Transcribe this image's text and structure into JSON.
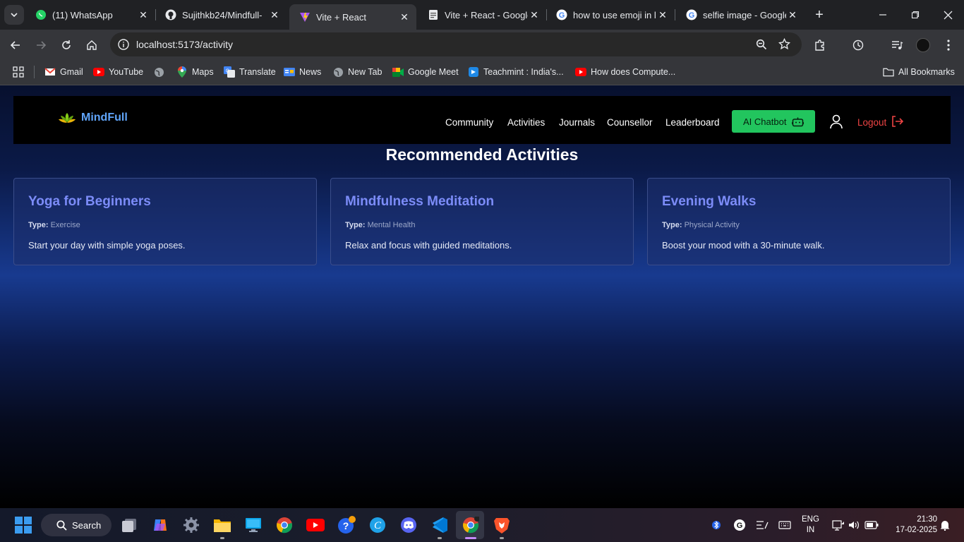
{
  "browser": {
    "tabs": [
      {
        "title": "(11) WhatsApp",
        "icon": "whatsapp-icon",
        "active": false
      },
      {
        "title": "Sujithkb24/Mindfull-",
        "icon": "github-icon",
        "active": false
      },
      {
        "title": "Vite + React",
        "icon": "vite-icon",
        "active": true
      },
      {
        "title": "Vite + React - Google",
        "icon": "google-docs-icon",
        "active": false
      },
      {
        "title": "how to use emoji in l",
        "icon": "google-icon",
        "active": false
      },
      {
        "title": "selfie image - Google",
        "icon": "google-icon",
        "active": false
      }
    ],
    "url": "localhost:5173/activity",
    "bookmarks": [
      {
        "label": "Gmail",
        "icon": "gmail-icon"
      },
      {
        "label": "YouTube",
        "icon": "youtube-icon"
      },
      {
        "label": "",
        "icon": "globe-icon"
      },
      {
        "label": "Maps",
        "icon": "maps-icon"
      },
      {
        "label": "Translate",
        "icon": "translate-icon"
      },
      {
        "label": "News",
        "icon": "news-icon"
      },
      {
        "label": "New Tab",
        "icon": "globe-icon"
      },
      {
        "label": "Google Meet",
        "icon": "meet-icon"
      },
      {
        "label": "Teachmint : India's...",
        "icon": "teachmint-icon"
      },
      {
        "label": "How does Compute...",
        "icon": "youtube-icon"
      }
    ],
    "all_bookmarks": "All Bookmarks"
  },
  "app": {
    "logo": "MindFull",
    "nav": [
      "Community",
      "Activities",
      "Journals",
      "Counsellor",
      "Leaderboard"
    ],
    "chatbot_label": "AI Chatbot",
    "logout_label": "Logout",
    "heading": "Recommended Activities",
    "activities": [
      {
        "title": "Yoga for Beginners",
        "type_label": "Type:",
        "type": "Exercise",
        "description": "Start your day with simple yoga poses."
      },
      {
        "title": "Mindfulness Meditation",
        "type_label": "Type:",
        "type": "Mental Health",
        "description": "Relax and focus with guided meditations."
      },
      {
        "title": "Evening Walks",
        "type_label": "Type:",
        "type": "Physical Activity",
        "description": "Boost your mood with a 30-minute walk."
      }
    ]
  },
  "taskbar": {
    "search_label": "Search",
    "lang_top": "ENG",
    "lang_bottom": "IN",
    "time": "21:30",
    "date": "17-02-2025"
  },
  "colors": {
    "accent_green": "#22c55e",
    "logout_red": "#ef4444",
    "card_title": "#7c8cf8",
    "logo_blue": "#60a5fa"
  }
}
